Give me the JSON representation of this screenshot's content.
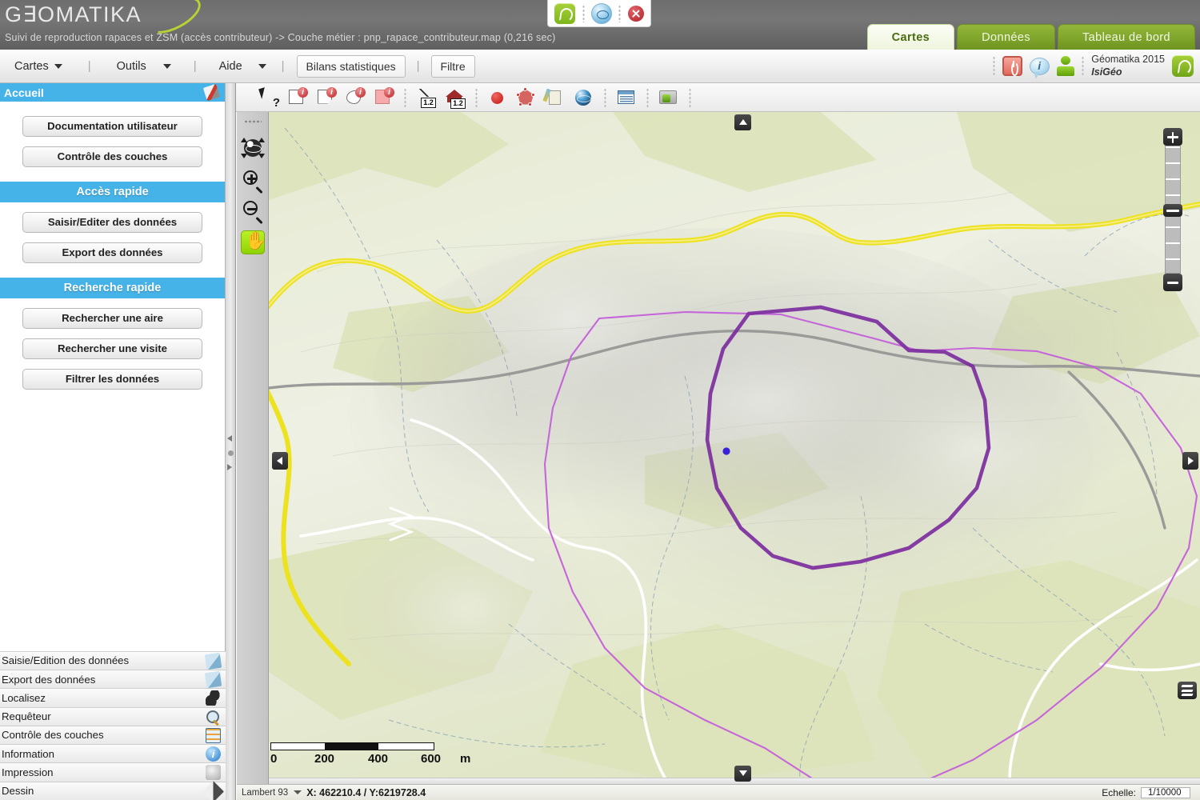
{
  "app": {
    "logo_text": "G∃OMATIKA",
    "subtitle": "Suivi de reproduction rapaces et ZSM (accès contributeur) -> Couche métier : pnp_rapace_contributeur.map (0,216 sec)"
  },
  "center_tools": {
    "leaf_icon": "leaf-green-icon",
    "globe_icon": "globe-blue-icon",
    "close_icon": "close-red-icon"
  },
  "tabs": [
    {
      "label": "Cartes",
      "active": true
    },
    {
      "label": "Données",
      "active": false
    },
    {
      "label": "Tableau de bord",
      "active": false
    }
  ],
  "menubar": {
    "items": [
      {
        "label": "Cartes",
        "has_caret": true
      },
      {
        "label": "Outils",
        "has_caret": true
      },
      {
        "label": "Aide",
        "has_caret": true
      }
    ],
    "buttons": [
      {
        "label": "Bilans statistiques"
      },
      {
        "label": "Filtre"
      }
    ],
    "icons": [
      "power-icon",
      "info-bubble-icon",
      "user-icon"
    ],
    "brand_line1": "Géomatika 2015",
    "brand_line2": "IsiGéo",
    "brand_button_icon": "leaf-green-icon"
  },
  "sidebar": {
    "title": "Accueil",
    "pin_icon": "pin-icon",
    "top_buttons": [
      {
        "label": "Documentation utilisateur"
      },
      {
        "label": "Contrôle des couches"
      }
    ],
    "sections": [
      {
        "band": "Accès rapide",
        "buttons": [
          {
            "label": "Saisir/Editer des données"
          },
          {
            "label": "Export des données"
          }
        ]
      },
      {
        "band": "Recherche rapide",
        "buttons": [
          {
            "label": "Rechercher une aire"
          },
          {
            "label": "Rechercher une visite"
          },
          {
            "label": "Filtrer les données"
          }
        ]
      }
    ],
    "list": [
      {
        "label": "Saisie/Edition des données",
        "icon": "pencil-blue-icon"
      },
      {
        "label": "Export des données",
        "icon": "pencil-blue-icon"
      },
      {
        "label": "Localisez",
        "icon": "footprint-icon"
      },
      {
        "label": "Requêteur",
        "icon": "magnify-query-icon"
      },
      {
        "label": "Contrôle des couches",
        "icon": "layers-list-icon"
      },
      {
        "label": "Information",
        "icon": "info-circle-icon"
      },
      {
        "label": "Impression",
        "icon": "printer-icon"
      },
      {
        "label": "Dessin",
        "icon": "draw-pencil-icon"
      }
    ]
  },
  "map_toolbar": {
    "tools": [
      {
        "name": "select-pointer-tool",
        "title": "Sélection"
      },
      {
        "name": "info-rectangle-tool",
        "title": "Info rectangle"
      },
      {
        "name": "info-polygon-tool",
        "title": "Info polygone"
      },
      {
        "name": "info-circle-tool",
        "title": "Info cercle"
      },
      {
        "name": "info-fill-tool",
        "title": "Info surface"
      },
      {
        "name": "measure-line-tool",
        "title": "Mesure ligne"
      },
      {
        "name": "measure-area-tool",
        "title": "Mesure surface"
      },
      {
        "name": "point-add-tool",
        "title": "Ajouter point"
      },
      {
        "name": "polygon-edit-tool",
        "title": "Éditer polygone"
      },
      {
        "name": "annotate-tool",
        "title": "Annoter"
      },
      {
        "name": "globe-tool",
        "title": "Globe"
      },
      {
        "name": "attribute-table-tool",
        "title": "Table attributaire"
      },
      {
        "name": "folder-export-tool",
        "title": "Export"
      }
    ],
    "badge_label": "i",
    "measure_label": "1.2"
  },
  "map_tools_left": {
    "globe_icon": "globe-extent-icon",
    "zoom_in_icon": "zoom-in-icon",
    "zoom_out_icon": "zoom-out-icon",
    "pan_icon": "pan-hand-icon",
    "pan_active": true
  },
  "map_controls": {
    "zoom_in_label": "+",
    "zoom_out_label": "−",
    "layers_icon": "layers-icon",
    "nav_up_icon": "arrow-up-icon",
    "nav_down_icon": "arrow-down-icon",
    "nav_left_icon": "arrow-left-icon",
    "nav_right_icon": "arrow-right-icon"
  },
  "scalebar": {
    "ticks": [
      "0",
      "200",
      "400",
      "600"
    ],
    "unit": "m"
  },
  "statusbar": {
    "projection": "Lambert 93",
    "coordinates": "X: 462210.4 / Y:6219728.4",
    "scale_label": "Echelle:",
    "scale_value": "1/10000"
  },
  "colors": {
    "accent_blue": "#45b3e8",
    "tab_green": "#7fa52b",
    "polygon_outer": "#c060d8",
    "polygon_inner": "#7a2f9e",
    "point_marker": "#3a22d8",
    "road_yellow": "#f5e02c",
    "map_green": "#dfe4bf"
  }
}
